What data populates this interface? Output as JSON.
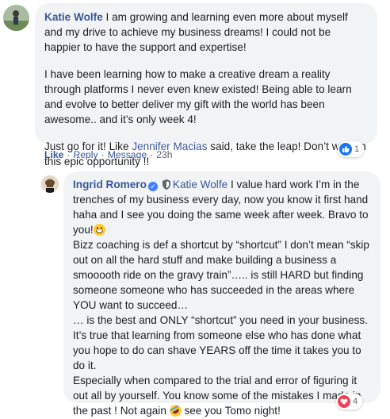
{
  "comment1": {
    "author": "Katie Wolfe",
    "text_intro": " I am growing and learning even more about myself and my drive to achieve my business dreams! I could not be happier to have the support and expertise!",
    "paragraph2": "I have been learning how to make a creative dream a reality through platforms I never even knew existed! Being able to learn and evolve to better deliver my gift with the world has been awesome.. and it’s only week 4!",
    "paragraph3_before": "Just go for it! Like ",
    "paragraph3_mention": "Jennifer Macias",
    "paragraph3_after": " said, take the leap! Don’t wait on this epic opportunity !!",
    "actions": {
      "like": "Like",
      "reply": "Reply",
      "message": "Message",
      "time": "23h"
    },
    "reaction_count": "1"
  },
  "comment2": {
    "author": "Ingrid Romero",
    "mention": "Katie Wolfe",
    "line1_after_mention": " I value hard work I’m in the trenches of my business every day, now you know it first hand haha and I see you doing the same week after week. Bravo to you!",
    "line2": "Bizz coaching is def a shortcut by “shortcut” I don’t mean “skip out on all the hard stuff and make building a business a smooooth ride on the gravy train”….. is still HARD but finding someone someone who has succeeded in the areas where YOU want to succeed…",
    "line3": "… is the best and ONLY “shortcut” you need in your business.",
    "line4": "It’s true that learning from someone else who has done what you hope to do can shave YEARS off the time it takes you to do it.",
    "line5_before": "Especially when compared to the trial and error of figuring it out all by yourself. You know some of the mistakes I made in the past ! Not again ",
    "line5_after": " see you Tomo night!",
    "reaction_count": "4"
  },
  "colors": {
    "link": "#385898",
    "bubble": "#f2f3f5",
    "like_blue": "#1877f2",
    "love_red": "#f33e58"
  },
  "icons": {
    "verified": "verified-badge-icon",
    "shield": "admin-shield-icon",
    "grin": "grinning-emoji-icon",
    "rofl": "rofl-emoji-icon",
    "like": "like-reaction-icon",
    "love": "love-reaction-icon"
  }
}
